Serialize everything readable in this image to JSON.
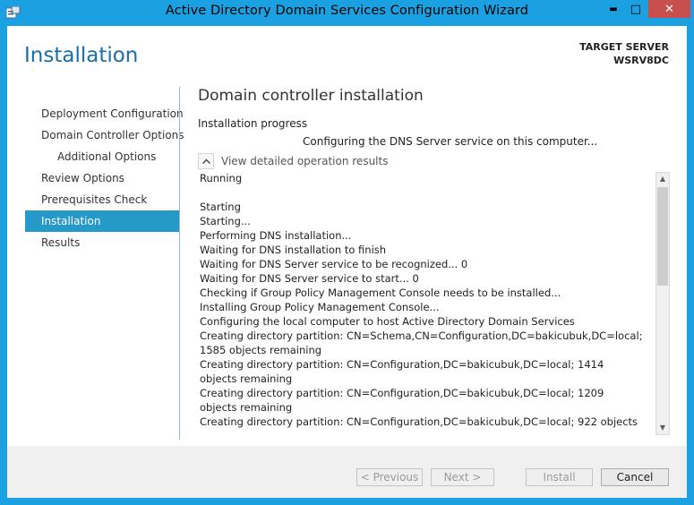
{
  "window": {
    "title": "Active Directory Domain Services Configuration Wizard",
    "accent": "#1ba1e2",
    "close_color": "#c7504f",
    "controls": {
      "minimize": "▬",
      "maximize": "□",
      "close": "✕"
    }
  },
  "header": {
    "page_title": "Installation",
    "target_server_label": "TARGET SERVER",
    "target_server_name": "WSRV8DC"
  },
  "sidebar": {
    "items": [
      {
        "label": "Deployment Configuration"
      },
      {
        "label": "Domain Controller Options"
      },
      {
        "label": "Additional Options"
      },
      {
        "label": "Review Options"
      },
      {
        "label": "Prerequisites Check"
      },
      {
        "label": "Installation"
      },
      {
        "label": "Results"
      }
    ],
    "active_index": 5,
    "active_color": "#2599c7"
  },
  "main": {
    "title": "Domain controller installation",
    "progress_label": "Installation progress",
    "progress_status": "Configuring the DNS Server service on this computer...",
    "details_toggle": "View detailed operation results",
    "log": {
      "lines": [
        "Running",
        "",
        "Starting",
        "Starting...",
        "Performing DNS installation...",
        "Waiting for DNS installation to finish",
        "Waiting for DNS Server service to be recognized... 0",
        "Waiting for DNS Server service to start... 0",
        "Checking if Group Policy Management Console needs to be installed...",
        "Installing Group Policy Management Console...",
        "Configuring the local computer to host Active Directory Domain Services",
        "Creating directory partition: CN=Schema,CN=Configuration,DC=bakicubuk,DC=local; 1585 objects remaining",
        "Creating directory partition: CN=Configuration,DC=bakicubuk,DC=local; 1414 objects remaining",
        "Creating directory partition: CN=Configuration,DC=bakicubuk,DC=local; 1209 objects remaining",
        "Creating directory partition: CN=Configuration,DC=bakicubuk,DC=local; 922 objects"
      ]
    }
  },
  "footer": {
    "previous": "< Previous",
    "next": "Next >",
    "install": "Install",
    "cancel": "Cancel"
  }
}
